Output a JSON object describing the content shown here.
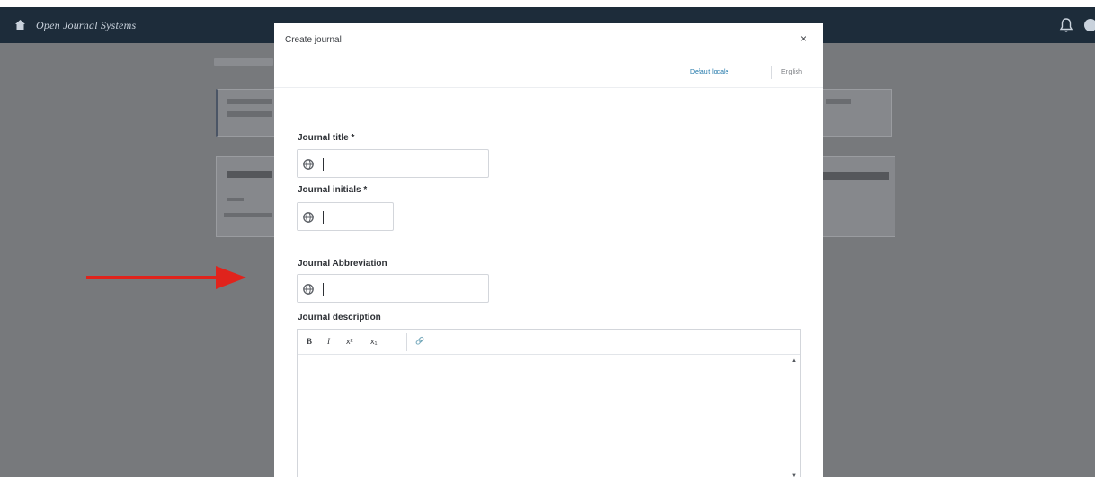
{
  "app": {
    "brand": "Open Journal Systems",
    "icons": {
      "brand": "home-icon",
      "notifications": "bell-icon",
      "user": "user-avatar-icon"
    }
  },
  "modal": {
    "title": "Create journal",
    "close_symbol": "×",
    "languages": {
      "default_label": "Default locale",
      "english_label": "English"
    },
    "fields": {
      "journal_title": {
        "label": "Journal title *",
        "value": ""
      },
      "journal_initials": {
        "label": "Journal initials *",
        "value": ""
      },
      "journal_abbreviation": {
        "label": "Journal Abbreviation",
        "value": ""
      },
      "journal_description": {
        "label": "Journal description",
        "value": ""
      }
    },
    "editor_toolbar": {
      "bold": "B",
      "italic": "I",
      "superscript": "x²",
      "subscript": "x₁",
      "link": "🔗"
    }
  },
  "annotation": {
    "arrow_color": "#e0231c",
    "icon": "arrow-right-icon"
  },
  "colors": {
    "topbar": "#1d2c3a",
    "overlay": "#77797c",
    "link": "#1d75a8"
  }
}
